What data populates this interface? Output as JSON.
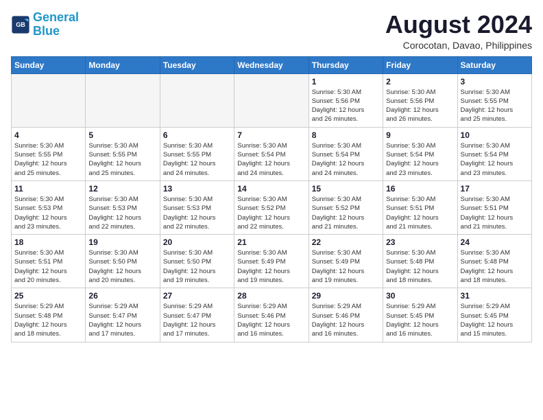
{
  "header": {
    "logo_line1": "General",
    "logo_line2": "Blue",
    "month_year": "August 2024",
    "location": "Corocotan, Davao, Philippines"
  },
  "weekdays": [
    "Sunday",
    "Monday",
    "Tuesday",
    "Wednesday",
    "Thursday",
    "Friday",
    "Saturday"
  ],
  "weeks": [
    [
      {
        "day": "",
        "info": ""
      },
      {
        "day": "",
        "info": ""
      },
      {
        "day": "",
        "info": ""
      },
      {
        "day": "",
        "info": ""
      },
      {
        "day": "1",
        "info": "Sunrise: 5:30 AM\nSunset: 5:56 PM\nDaylight: 12 hours\nand 26 minutes."
      },
      {
        "day": "2",
        "info": "Sunrise: 5:30 AM\nSunset: 5:56 PM\nDaylight: 12 hours\nand 26 minutes."
      },
      {
        "day": "3",
        "info": "Sunrise: 5:30 AM\nSunset: 5:55 PM\nDaylight: 12 hours\nand 25 minutes."
      }
    ],
    [
      {
        "day": "4",
        "info": "Sunrise: 5:30 AM\nSunset: 5:55 PM\nDaylight: 12 hours\nand 25 minutes."
      },
      {
        "day": "5",
        "info": "Sunrise: 5:30 AM\nSunset: 5:55 PM\nDaylight: 12 hours\nand 25 minutes."
      },
      {
        "day": "6",
        "info": "Sunrise: 5:30 AM\nSunset: 5:55 PM\nDaylight: 12 hours\nand 24 minutes."
      },
      {
        "day": "7",
        "info": "Sunrise: 5:30 AM\nSunset: 5:54 PM\nDaylight: 12 hours\nand 24 minutes."
      },
      {
        "day": "8",
        "info": "Sunrise: 5:30 AM\nSunset: 5:54 PM\nDaylight: 12 hours\nand 24 minutes."
      },
      {
        "day": "9",
        "info": "Sunrise: 5:30 AM\nSunset: 5:54 PM\nDaylight: 12 hours\nand 23 minutes."
      },
      {
        "day": "10",
        "info": "Sunrise: 5:30 AM\nSunset: 5:54 PM\nDaylight: 12 hours\nand 23 minutes."
      }
    ],
    [
      {
        "day": "11",
        "info": "Sunrise: 5:30 AM\nSunset: 5:53 PM\nDaylight: 12 hours\nand 23 minutes."
      },
      {
        "day": "12",
        "info": "Sunrise: 5:30 AM\nSunset: 5:53 PM\nDaylight: 12 hours\nand 22 minutes."
      },
      {
        "day": "13",
        "info": "Sunrise: 5:30 AM\nSunset: 5:53 PM\nDaylight: 12 hours\nand 22 minutes."
      },
      {
        "day": "14",
        "info": "Sunrise: 5:30 AM\nSunset: 5:52 PM\nDaylight: 12 hours\nand 22 minutes."
      },
      {
        "day": "15",
        "info": "Sunrise: 5:30 AM\nSunset: 5:52 PM\nDaylight: 12 hours\nand 21 minutes."
      },
      {
        "day": "16",
        "info": "Sunrise: 5:30 AM\nSunset: 5:51 PM\nDaylight: 12 hours\nand 21 minutes."
      },
      {
        "day": "17",
        "info": "Sunrise: 5:30 AM\nSunset: 5:51 PM\nDaylight: 12 hours\nand 21 minutes."
      }
    ],
    [
      {
        "day": "18",
        "info": "Sunrise: 5:30 AM\nSunset: 5:51 PM\nDaylight: 12 hours\nand 20 minutes."
      },
      {
        "day": "19",
        "info": "Sunrise: 5:30 AM\nSunset: 5:50 PM\nDaylight: 12 hours\nand 20 minutes."
      },
      {
        "day": "20",
        "info": "Sunrise: 5:30 AM\nSunset: 5:50 PM\nDaylight: 12 hours\nand 19 minutes."
      },
      {
        "day": "21",
        "info": "Sunrise: 5:30 AM\nSunset: 5:49 PM\nDaylight: 12 hours\nand 19 minutes."
      },
      {
        "day": "22",
        "info": "Sunrise: 5:30 AM\nSunset: 5:49 PM\nDaylight: 12 hours\nand 19 minutes."
      },
      {
        "day": "23",
        "info": "Sunrise: 5:30 AM\nSunset: 5:48 PM\nDaylight: 12 hours\nand 18 minutes."
      },
      {
        "day": "24",
        "info": "Sunrise: 5:30 AM\nSunset: 5:48 PM\nDaylight: 12 hours\nand 18 minutes."
      }
    ],
    [
      {
        "day": "25",
        "info": "Sunrise: 5:29 AM\nSunset: 5:48 PM\nDaylight: 12 hours\nand 18 minutes."
      },
      {
        "day": "26",
        "info": "Sunrise: 5:29 AM\nSunset: 5:47 PM\nDaylight: 12 hours\nand 17 minutes."
      },
      {
        "day": "27",
        "info": "Sunrise: 5:29 AM\nSunset: 5:47 PM\nDaylight: 12 hours\nand 17 minutes."
      },
      {
        "day": "28",
        "info": "Sunrise: 5:29 AM\nSunset: 5:46 PM\nDaylight: 12 hours\nand 16 minutes."
      },
      {
        "day": "29",
        "info": "Sunrise: 5:29 AM\nSunset: 5:46 PM\nDaylight: 12 hours\nand 16 minutes."
      },
      {
        "day": "30",
        "info": "Sunrise: 5:29 AM\nSunset: 5:45 PM\nDaylight: 12 hours\nand 16 minutes."
      },
      {
        "day": "31",
        "info": "Sunrise: 5:29 AM\nSunset: 5:45 PM\nDaylight: 12 hours\nand 15 minutes."
      }
    ]
  ]
}
